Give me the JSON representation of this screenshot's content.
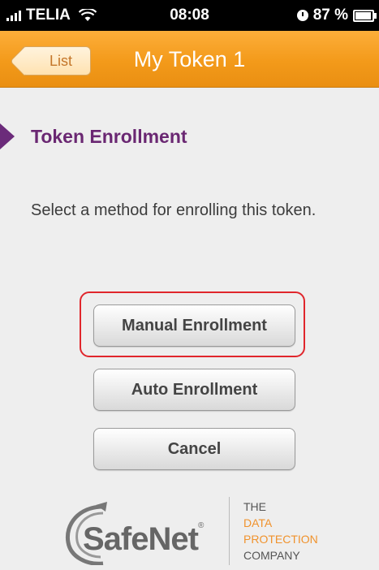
{
  "status_bar": {
    "carrier": "TELIA",
    "time": "08:08",
    "battery": "87 %",
    "battery_level": 0.87
  },
  "nav": {
    "back_label": "List",
    "title": "My Token 1"
  },
  "section": {
    "heading": "Token Enrollment",
    "description": "Select a method for enrolling this token."
  },
  "buttons": {
    "manual": "Manual Enrollment",
    "auto": "Auto Enrollment",
    "cancel": "Cancel"
  },
  "logo": {
    "brand": "SafeNet",
    "reg_mark": "®",
    "tag_line1": "THE",
    "tag_line2": "DATA",
    "tag_line3": "PROTECTION",
    "tag_line4": "COMPANY"
  },
  "colors": {
    "nav_orange": "#f39a1a",
    "heading_purple": "#6a2772",
    "highlight_red": "#e0262c"
  }
}
